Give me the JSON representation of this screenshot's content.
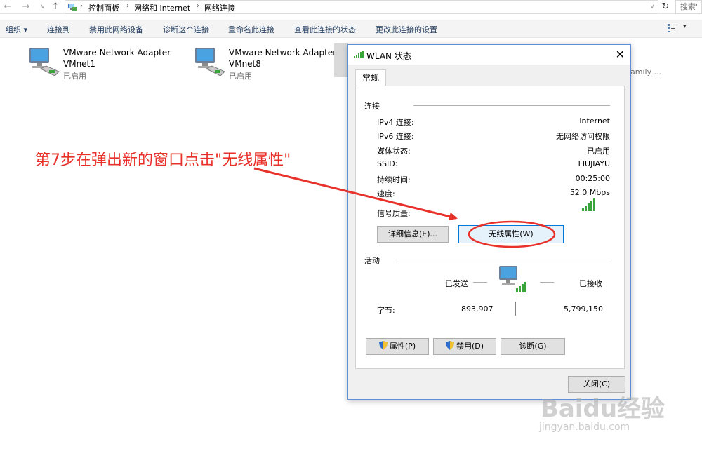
{
  "address": {
    "crumbs": [
      "控制面板",
      "网络和 Internet",
      "网络连接"
    ],
    "search_placeholder": "搜索\""
  },
  "commands": [
    "组织 ▾",
    "连接到",
    "禁用此网络设备",
    "诊断这个连接",
    "重命名此连接",
    "查看此连接的状态",
    "更改此连接的设置"
  ],
  "adapters": [
    {
      "name1": "VMware Network Adapter",
      "name2": "VMnet1",
      "status": "已启用"
    },
    {
      "name1": "VMware Network Adapter",
      "name2": "VMnet8",
      "status": "已启用"
    }
  ],
  "partial_adapter_text": "amily ...",
  "dialog": {
    "title": "WLAN 状态",
    "tab": "常规",
    "connection_section": "连接",
    "rows": [
      {
        "label": "IPv4 连接:",
        "value": "Internet"
      },
      {
        "label": "IPv6 连接:",
        "value": "无网络访问权限"
      },
      {
        "label": "媒体状态:",
        "value": "已启用"
      },
      {
        "label": "SSID:",
        "value": "LIUJIAYU"
      },
      {
        "label": "持续时间:",
        "value": "00:25:00"
      },
      {
        "label": "速度:",
        "value": "52.0 Mbps"
      }
    ],
    "signal_label": "信号质量:",
    "signal_bars": 5,
    "details_button": "详细信息(E)...",
    "wireless_props_button": "无线属性(W)",
    "activity_section": "活动",
    "sent_label": "已发送",
    "received_label": "已接收",
    "bytes_label": "字节:",
    "bytes_sent": "893,907",
    "bytes_received": "5,799,150",
    "properties_button": "属性(P)",
    "disable_button": "禁用(D)",
    "diagnose_button": "诊断(G)",
    "close_button": "关闭(C)"
  },
  "annotation": "第7步在弹出新的窗口点击\"无线属性\"",
  "watermark": {
    "logo": "Baidu经验",
    "url": "jingyan.baidu.com"
  },
  "colors": {
    "annotation_red": "#e8312a",
    "accent_blue": "#0078d7",
    "signal_green": "#3aa53a"
  }
}
